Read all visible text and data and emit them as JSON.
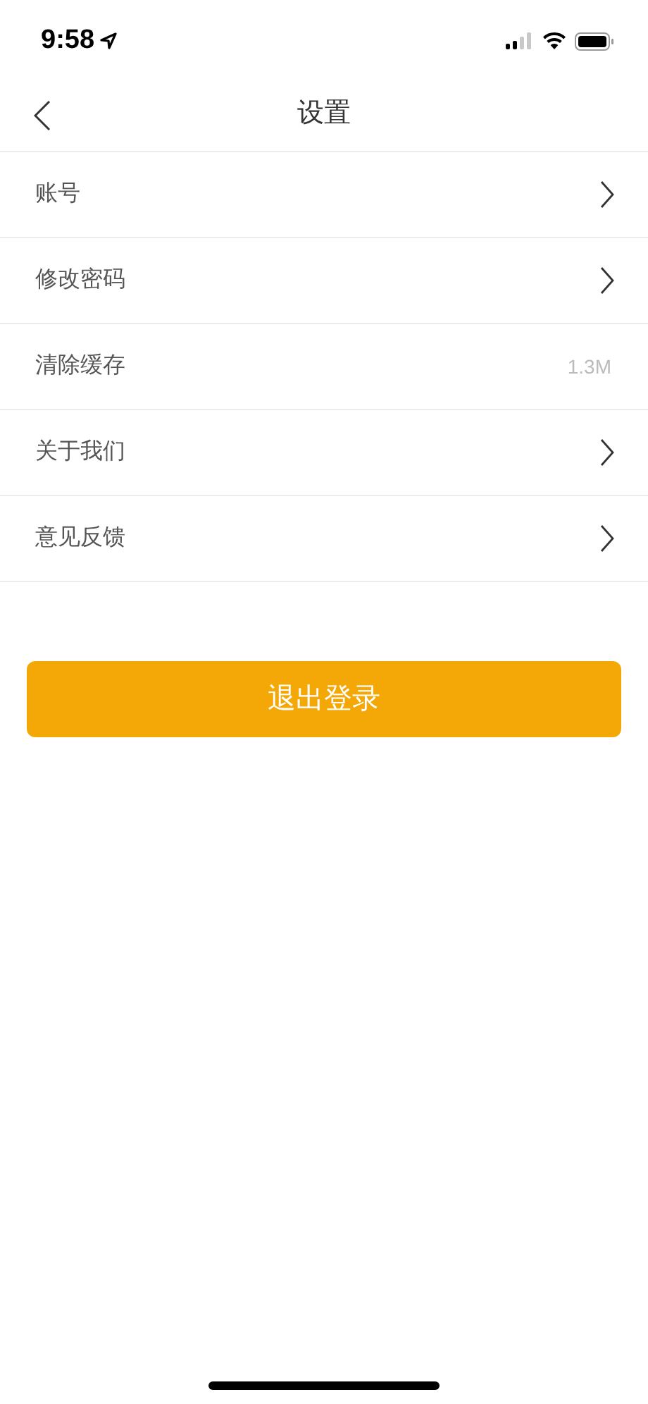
{
  "status_bar": {
    "time": "9:58"
  },
  "nav_bar": {
    "title": "设置"
  },
  "settings": [
    {
      "label": "账号",
      "kind": "link"
    },
    {
      "label": "修改密码",
      "kind": "link"
    },
    {
      "label": "清除缓存",
      "kind": "value",
      "value": "1.3M"
    },
    {
      "label": "关于我们",
      "kind": "link"
    },
    {
      "label": "意见反馈",
      "kind": "link"
    }
  ],
  "logout_button": {
    "label": "退出登录"
  }
}
